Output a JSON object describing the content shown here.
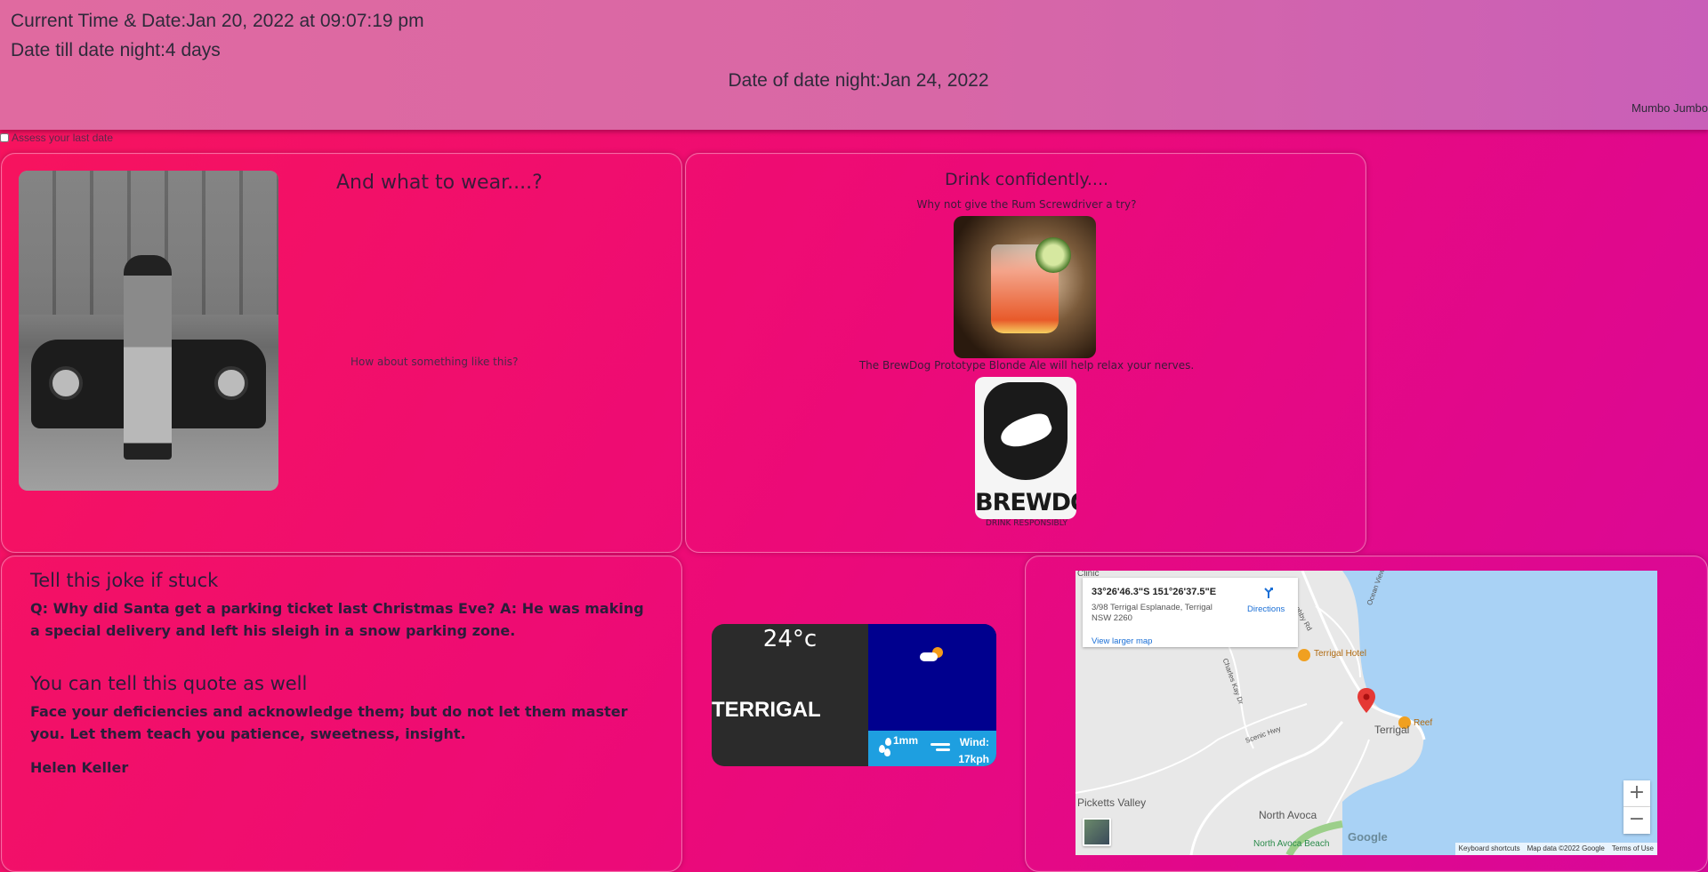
{
  "header": {
    "current_time": "Current Time & Date:Jan 20, 2022 at 09:07:19 pm",
    "days_till": "Date till date night:4 days",
    "date_night": "Date of date night:Jan 24, 2022",
    "brand": "Mumbo Jumbo"
  },
  "assess": {
    "label": "Assess your last date"
  },
  "wear": {
    "title": "And what to wear....?",
    "caption": "How about something like this?",
    "photo_name": "man-leaning-on-car-photo"
  },
  "drink": {
    "title": "Drink confidently....",
    "cocktail_text": "Why not give the Rum Screwdriver a try?",
    "beer_text": "The BrewDog Prototype Blonde Ale will help relax your nerves.",
    "beer_logo_word": "BREWDOG",
    "beer_caption": "DRINK RESPONSIBLY"
  },
  "joke": {
    "heading": "Tell this joke if stuck",
    "text": "Q: Why did Santa get a parking ticket last Christmas Eve? A: He was making a special delivery and left his sleigh in a snow parking zone.",
    "quote_heading": "You can tell this quote as well",
    "quote": "Face your deficiencies and acknowledge them; but do not let them master you. Let them teach you patience, sweetness, insight.",
    "author": "Helen Keller"
  },
  "weather": {
    "temp": "24°c",
    "city": "TERRIGAL",
    "rain": "1mm",
    "wind_label": "Wind:",
    "wind_value": "17kph",
    "condition_icon": "partly-cloudy-icon"
  },
  "map": {
    "coords": "33°26'46.3\"S 151°26'37.5\"E",
    "address": "3/98 Terrigal Esplanade, Terrigal NSW 2260",
    "view_larger": "View larger map",
    "directions": "Directions",
    "labels": {
      "terrigal_hotel": "Terrigal Hotel",
      "reef": "Reef",
      "terrigal": "Terrigal",
      "picketts_valley": "Picketts Valley",
      "north_avoca": "North Avoca",
      "north_avoca_beach": "North Avoca Beach",
      "clinic": "Clinic",
      "scenic_hwy": "Scenic Hwy",
      "ocean_view": "Ocean View",
      "charles_kay": "Charles Kay Dr",
      "willoughby": "Willoughby Rd"
    },
    "zoom_in": "+",
    "zoom_out": "−",
    "footer": [
      "Keyboard shortcuts",
      "Map data ©2022 Google",
      "Terms of Use"
    ],
    "google": "Google"
  }
}
